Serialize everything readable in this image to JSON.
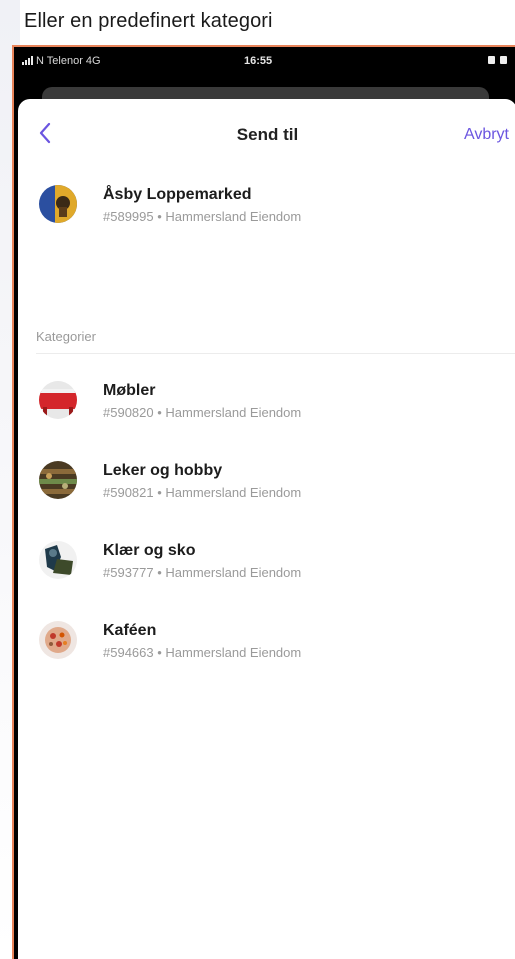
{
  "caption": "Eller en predefinert kategori",
  "status_bar": {
    "carrier": "N Telenor  4G",
    "time": "16:55"
  },
  "nav": {
    "back_icon": "chevron-left-icon",
    "title": "Send til",
    "cancel_label": "Avbryt"
  },
  "top_item": {
    "title": "Åsby Loppemarked",
    "subtitle": "#589995 • Hammersland Eiendom"
  },
  "section": {
    "label": "Kategorier"
  },
  "categories": [
    {
      "title": "Møbler",
      "subtitle": "#590820 • Hammersland Eiendom"
    },
    {
      "title": "Leker og hobby",
      "subtitle": "#590821 • Hammersland Eiendom"
    },
    {
      "title": "Klær og sko",
      "subtitle": "#593777 • Hammersland Eiendom"
    },
    {
      "title": "Kaféen",
      "subtitle": "#594663 • Hammersland Eiendom"
    }
  ],
  "colors": {
    "accent": "#6b55e0",
    "phone_border": "#e8845a"
  }
}
